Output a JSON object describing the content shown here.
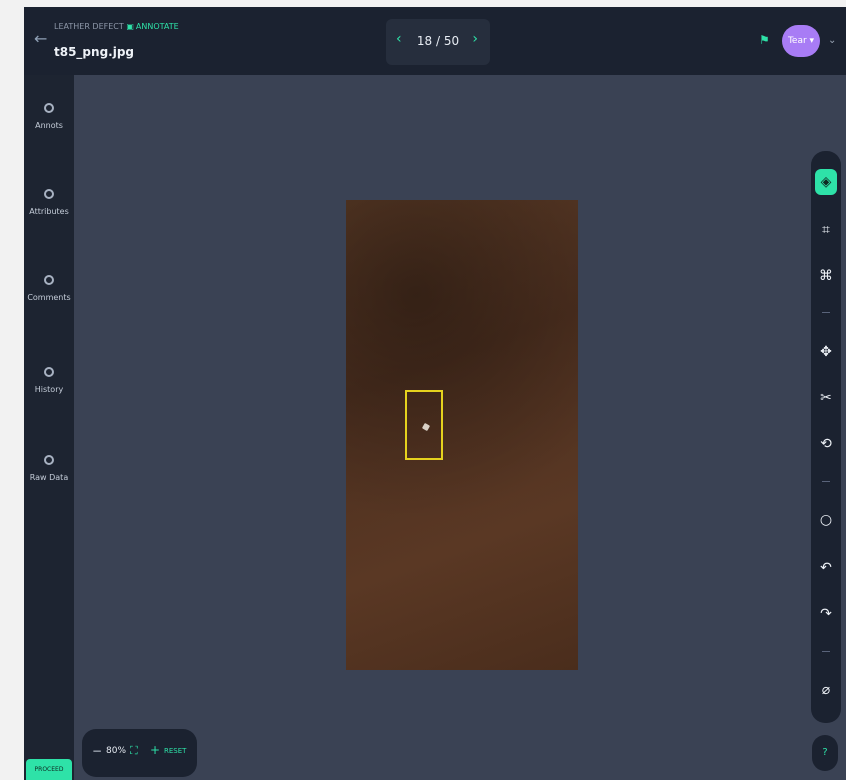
{
  "header": {
    "back_icon": "arrow-left-icon",
    "project": "LEATHER DEFECT",
    "mode": "ANNOTATE",
    "mode_icon": "annotate-icon",
    "file_name": "t85_png.jpg"
  },
  "pager": {
    "prev": "‹",
    "current": "18 / 50",
    "next": "›"
  },
  "user": {
    "label": "Tear ▾",
    "color": "#a87cf5"
  },
  "sidebar": {
    "items": [
      {
        "label": "Annots",
        "icon": "annotations-icon"
      },
      {
        "label": "Attributes",
        "icon": "attributes-icon"
      },
      {
        "label": "Comments",
        "icon": "comments-icon"
      },
      {
        "label": "History",
        "icon": "history-icon"
      },
      {
        "label": "Raw Data",
        "icon": "raw-data-icon"
      }
    ],
    "proceed_label": "PROCEED"
  },
  "zoom": {
    "minus": "−",
    "level": "80%",
    "plus": "+",
    "reset": "RESET"
  },
  "toolbar": {
    "tools": [
      "select-tool-icon",
      "bounding-box-icon",
      "polygon-icon",
      "transform-icon",
      "cut-icon",
      "rotate-icon",
      "comment-icon",
      "undo-icon",
      "redo-icon",
      "delete-icon"
    ],
    "help": "?"
  },
  "colors": {
    "accent": "#2ee2a8",
    "annotation": "#e5d21e"
  }
}
